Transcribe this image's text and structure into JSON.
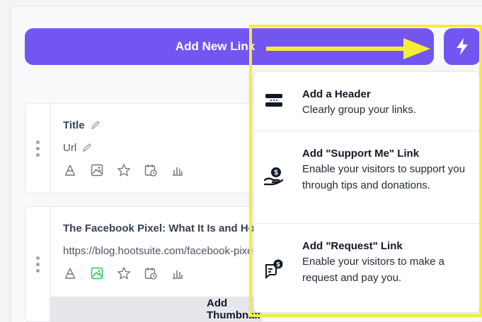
{
  "toolbar": {
    "add_new_link": "Add New Link"
  },
  "cards": [
    {
      "title": "Title",
      "url": "Url"
    },
    {
      "title": "The Facebook Pixel: What It Is and How",
      "url": "https://blog.hootsuite.com/facebook-pixel/"
    }
  ],
  "thumbnail_bar": {
    "label": "Add Thumbnail"
  },
  "menu": {
    "items": [
      {
        "title": "Add a Header",
        "description": "Clearly group your links."
      },
      {
        "title": "Add \"Support Me\" Link",
        "description": "Enable your visitors to support you through tips and donations."
      },
      {
        "title": "Add \"Request\" Link",
        "description": "Enable your visitors to make a request and pay you."
      }
    ]
  },
  "colors": {
    "accent": "#7355f2",
    "highlight": "#f5ec3a",
    "active_icon": "#22c55e"
  },
  "icons": [
    "lightning-icon",
    "drag-handle-icon",
    "pencil-icon",
    "share-icon",
    "image-icon",
    "star-icon",
    "schedule-icon",
    "analytics-icon",
    "header-icon",
    "donation-icon",
    "request-icon",
    "arrow-annotation"
  ]
}
